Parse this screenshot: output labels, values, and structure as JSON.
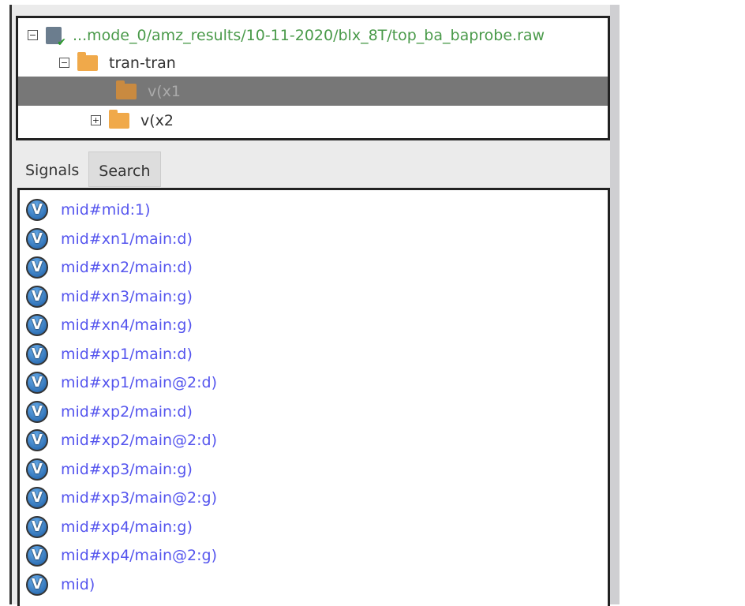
{
  "tree": {
    "items": [
      {
        "label": "...mode_0/amz_results/10-11-2020/blx_8T/top_ba_baprobe.raw",
        "icon": "database-icon",
        "expander": "−"
      },
      {
        "label": "tran-tran",
        "icon": "folder-open-icon",
        "expander": "−"
      },
      {
        "label": "v(x1",
        "icon": "folder-icon",
        "expander": "",
        "selected": true
      },
      {
        "label": "v(x2",
        "icon": "folder-icon",
        "expander": "+"
      }
    ]
  },
  "tabs": [
    {
      "label": "Signals"
    },
    {
      "label": "Search"
    }
  ],
  "signals": {
    "icon_glyph": "V",
    "items": [
      "mid#mid:1)",
      "mid#xn1/main:d)",
      "mid#xn2/main:d)",
      "mid#xn3/main:g)",
      "mid#xn4/main:g)",
      "mid#xp1/main:d)",
      "mid#xp1/main@2:d)",
      "mid#xp2/main:d)",
      "mid#xp2/main@2:d)",
      "mid#xp3/main:g)",
      "mid#xp3/main@2:g)",
      "mid#xp4/main:g)",
      "mid#xp4/main@2:g)",
      "mid)"
    ]
  }
}
